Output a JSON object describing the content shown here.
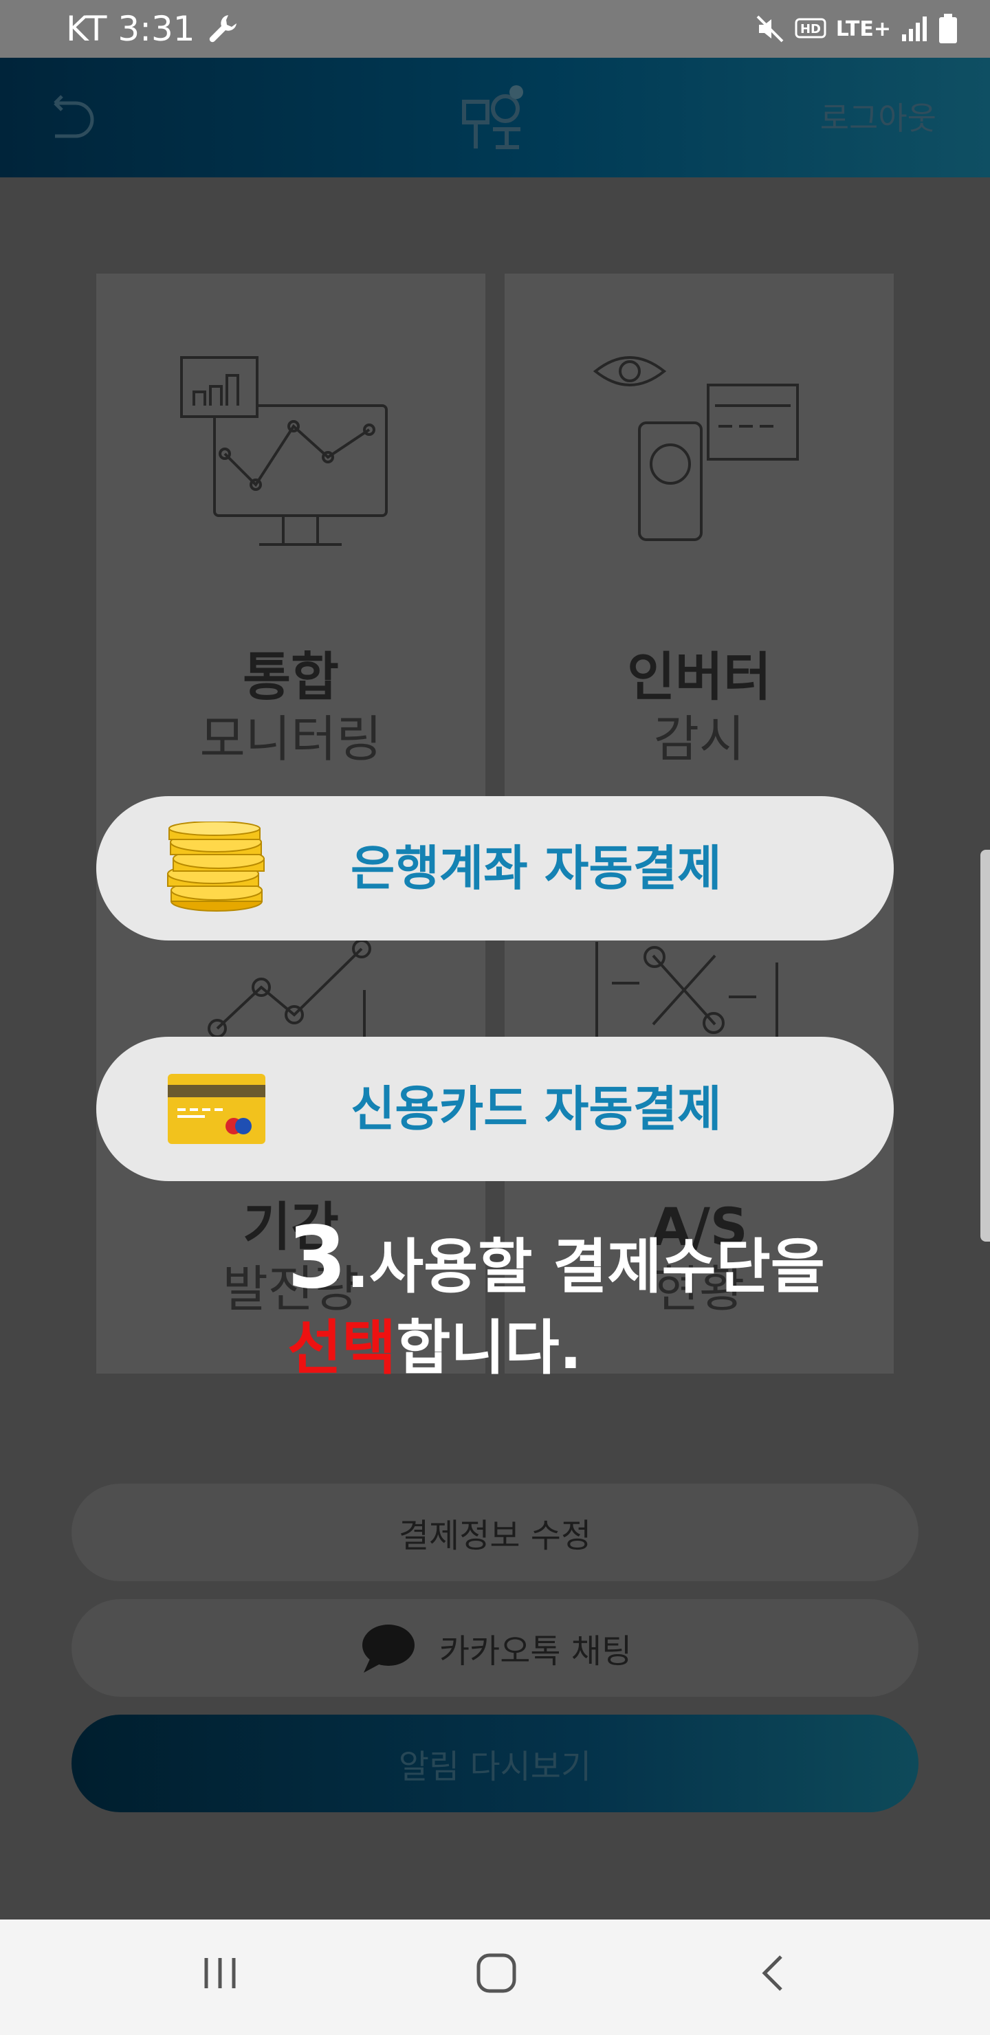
{
  "status_bar": {
    "carrier_time": "KT 3:31",
    "icons": [
      "wrench-icon",
      "mute-icon",
      "hd-icon",
      "lte-icon",
      "signal-icon",
      "battery-icon"
    ],
    "lte": "LTE+"
  },
  "header": {
    "logo_icon": "app-logo-icon",
    "logout_label": "로그아웃"
  },
  "tiles": [
    {
      "title": "통합",
      "subtitle": "모니터링",
      "icon": "monitor-chart-icon"
    },
    {
      "title": "인버터",
      "subtitle": "감시",
      "icon": "eye-devices-icon"
    },
    {
      "title": "기간",
      "subtitle": "발전량",
      "icon": "line-graph-icon"
    },
    {
      "title": "A/S",
      "subtitle": "현황",
      "icon": "tools-icon"
    }
  ],
  "buttons": {
    "payment_edit": "결제정보 수정",
    "kakao_chat": "카카오톡 채팅",
    "notification_review": "알림 다시보기"
  },
  "payment_options": [
    {
      "label": "은행계좌 자동결제",
      "icon": "coins-icon"
    },
    {
      "label": "신용카드 자동결제",
      "icon": "credit-card-icon"
    }
  ],
  "instruction": {
    "number": "3",
    "dot": ".",
    "line1_rest": "사용할 결제수단을",
    "line2_highlight": "선택",
    "line2_rest": "합니다."
  },
  "colors": {
    "accent_blue": "#1482b3",
    "highlight_red": "#ee1111",
    "header_dark": "#00243a"
  }
}
